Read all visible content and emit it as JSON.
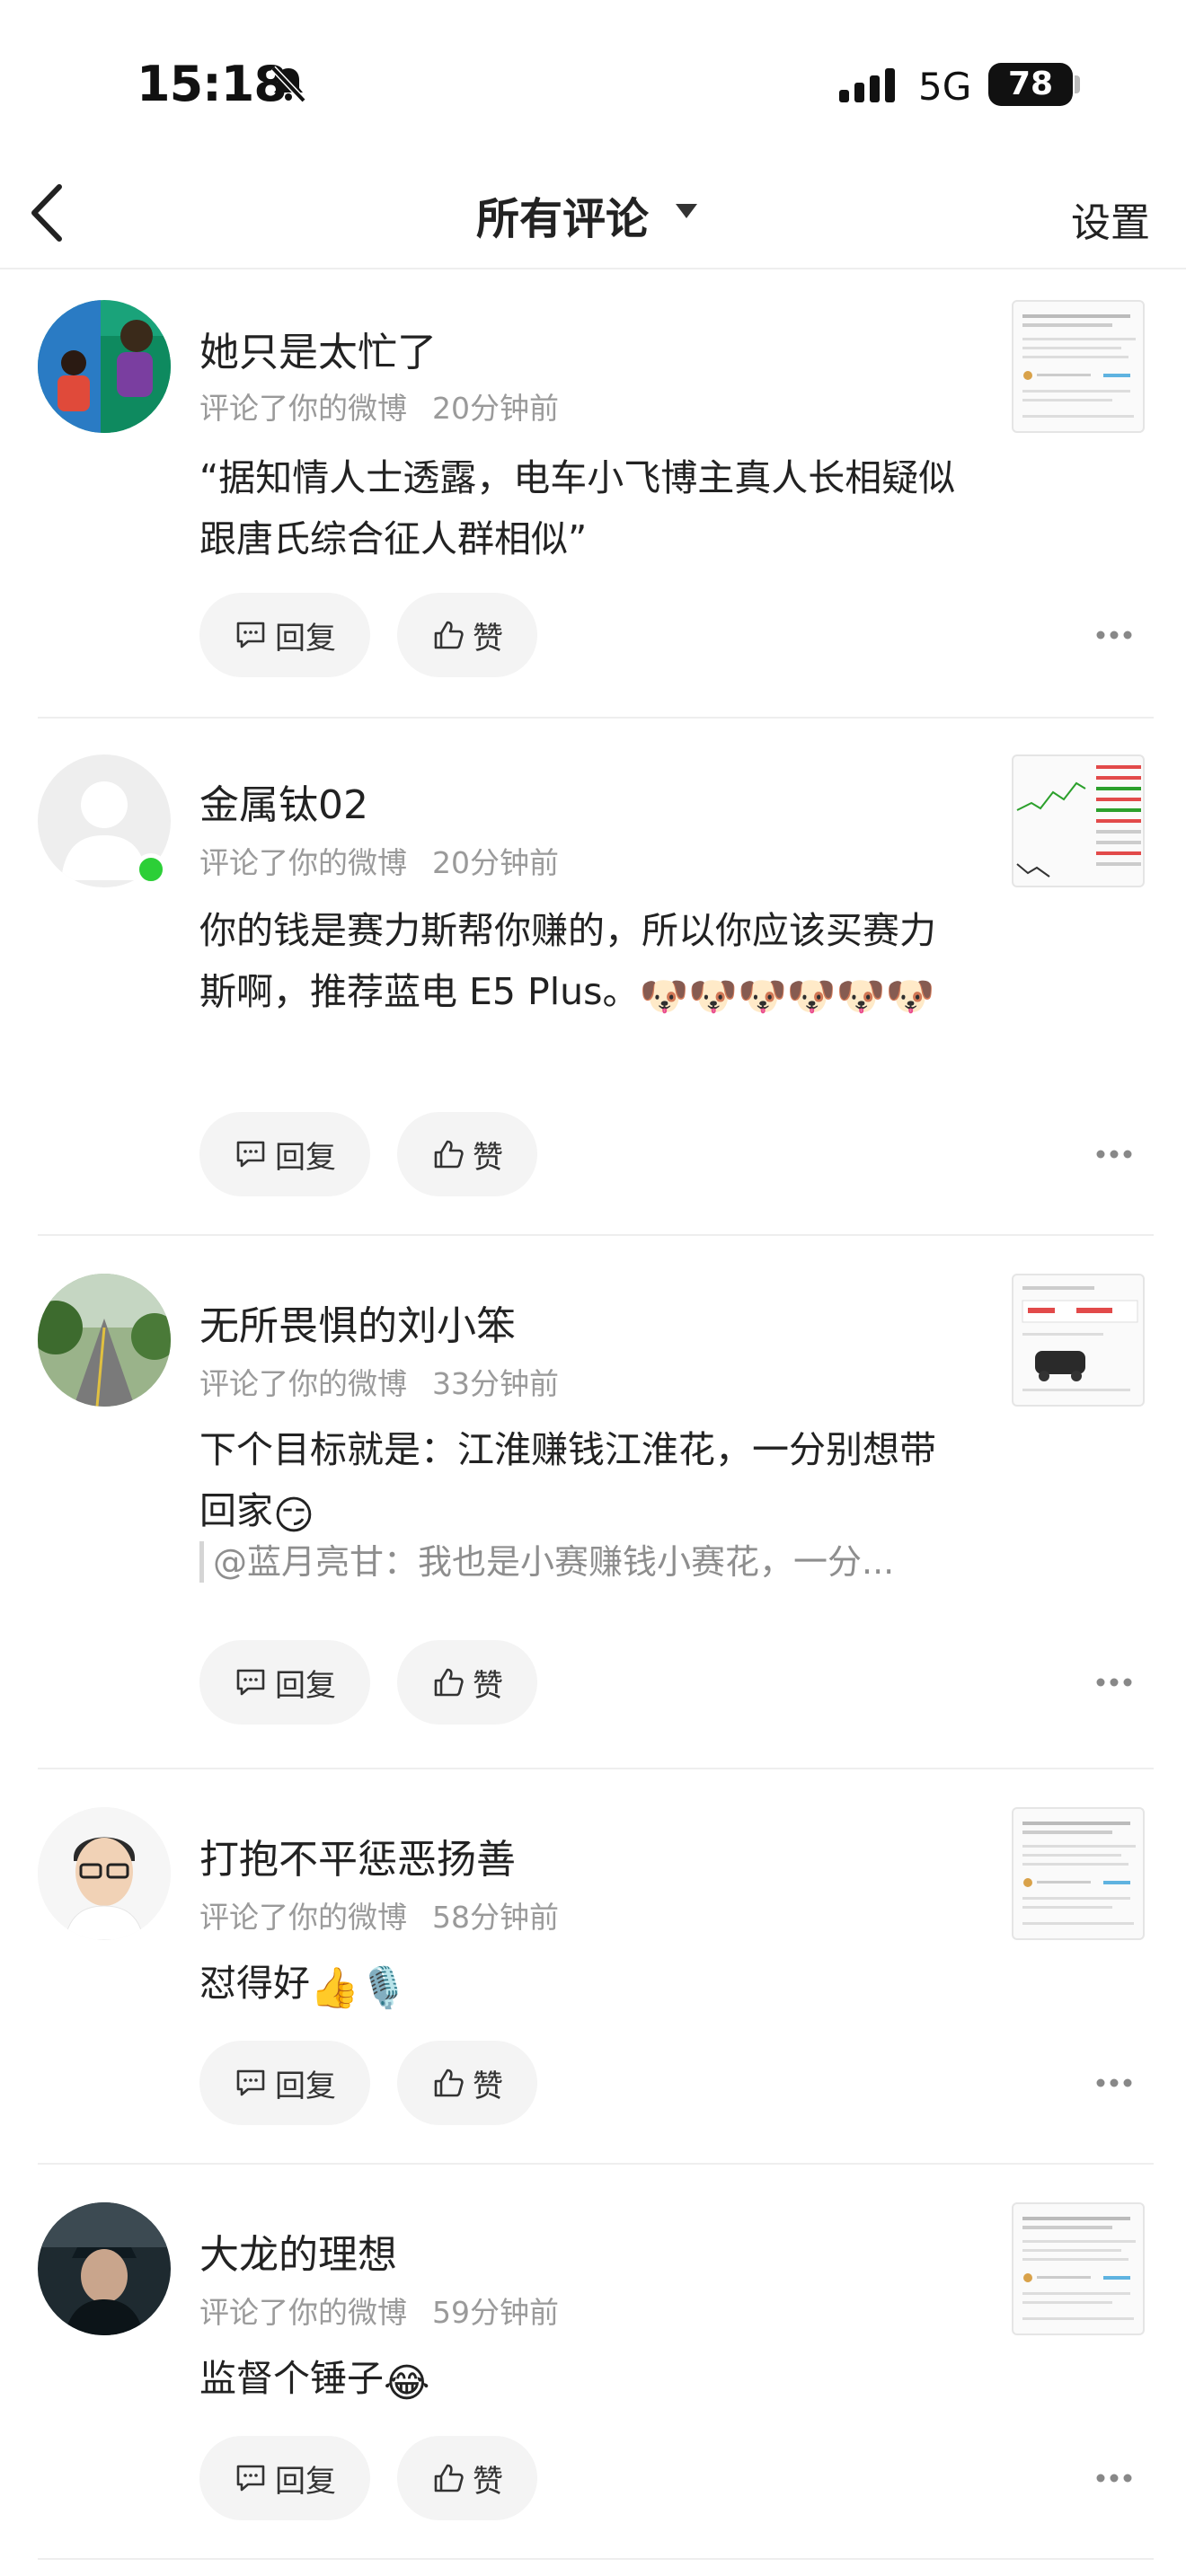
{
  "status_bar": {
    "time": "15:18",
    "network": "5G",
    "battery": "78"
  },
  "nav": {
    "title": "所有评论",
    "settings": "设置"
  },
  "actions": {
    "reply": "回复",
    "like": "赞"
  },
  "comments": [
    {
      "user": "她只是太忙了",
      "action": "评论了你的微博",
      "time": "20分钟前",
      "text": "“据知情人士透露，电车小飞博主真人长相疑似跟唐氏综合征人群相似”"
    },
    {
      "user": "金属钛02",
      "action": "评论了你的微博",
      "time": "20分钟前",
      "text": "你的钱是赛力斯帮你赚的，所以你应该买赛力斯啊，推荐蓝电 E5 Plus。",
      "emojis": "🐶🐶🐶🐶🐶🐶"
    },
    {
      "user": "无所畏惧的刘小笨",
      "action": "评论了你的微博",
      "time": "33分钟前",
      "text": "下个目标就是：江淮赚钱江淮花，一分别想带回家",
      "emojis": "😏",
      "quote": "@蓝月亮甘：我也是小赛赚钱小赛花，一分..."
    },
    {
      "user": "打抱不平惩恶扬善",
      "action": "评论了你的微博",
      "time": "58分钟前",
      "text": "怼得好",
      "emojis": "👍🎙️"
    },
    {
      "user": "大龙的理想",
      "action": "评论了你的微博",
      "time": "59分钟前",
      "text": "监督个锤子",
      "emojis": "😂"
    }
  ]
}
